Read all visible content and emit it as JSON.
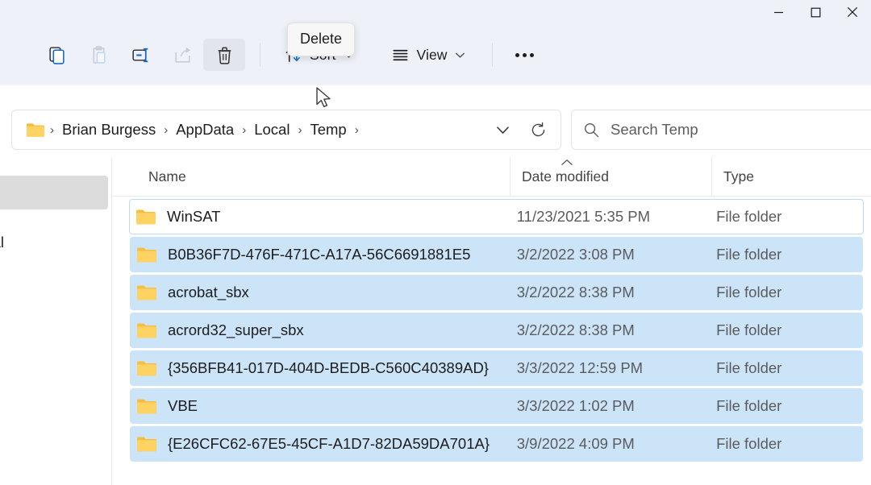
{
  "window": {
    "controls": [
      {
        "name": "minimize",
        "label": "Minimize",
        "glyph": "minimize-icon"
      },
      {
        "name": "maximize",
        "label": "Maximize",
        "glyph": "maximize-icon"
      },
      {
        "name": "close",
        "label": "Close",
        "glyph": "close-icon"
      }
    ]
  },
  "toolbar": {
    "copy_label": "Copy",
    "paste_label": "Paste",
    "rename_label": "Rename",
    "share_label": "Share",
    "delete_label": "Delete",
    "sort_label": "Sort",
    "view_label": "View",
    "more_label": "See more",
    "tooltip": "Delete",
    "tooltip_target": "delete-button"
  },
  "address": {
    "root_icon": "folder-icon",
    "separator": "›",
    "crumbs": [
      {
        "label": "Brian Burgess"
      },
      {
        "label": "AppData"
      },
      {
        "label": "Local"
      },
      {
        "label": "Temp"
      }
    ],
    "history_label": "Previous locations",
    "refresh_label": "Refresh"
  },
  "search": {
    "placeholder": "Search Temp",
    "value": "",
    "icon": "search-icon"
  },
  "nav_pane": {
    "visible_text": "onal"
  },
  "columns": {
    "name": "Name",
    "date_modified": "Date modified",
    "type": "Type",
    "sorted_by": "Date modified",
    "sort_direction": "ascending"
  },
  "files": [
    {
      "name": "WinSAT",
      "date": "11/23/2021 5:35 PM",
      "type": "File folder",
      "selected": false,
      "focused": true
    },
    {
      "name": "B0B36F7D-476F-471C-A17A-56C6691881E5",
      "date": "3/2/2022 3:08 PM",
      "type": "File folder",
      "selected": true,
      "focused": false
    },
    {
      "name": "acrobat_sbx",
      "date": "3/2/2022 8:38 PM",
      "type": "File folder",
      "selected": true,
      "focused": false
    },
    {
      "name": "acrord32_super_sbx",
      "date": "3/2/2022 8:38 PM",
      "type": "File folder",
      "selected": true,
      "focused": false
    },
    {
      "name": "{356BFB41-017D-404D-BEDB-C560C40389AD}",
      "date": "3/3/2022 12:59 PM",
      "type": "File folder",
      "selected": true,
      "focused": false
    },
    {
      "name": "VBE",
      "date": "3/3/2022 1:02 PM",
      "type": "File folder",
      "selected": true,
      "focused": false
    },
    {
      "name": "{E26CFC62-67E5-45CF-A1D7-82DA59DA701A}",
      "date": "3/9/2022 4:09 PM",
      "type": "File folder",
      "selected": true,
      "focused": false
    }
  ],
  "colors": {
    "chrome_background": "#eef1f8",
    "selection": "#cce4f7",
    "focus_border": "#bcdcf5",
    "accent_blue": "#0f6cbd",
    "folder_yellow": "#ffd264",
    "text_primary": "#1d1d1f",
    "text_secondary": "#5b5b5f"
  }
}
